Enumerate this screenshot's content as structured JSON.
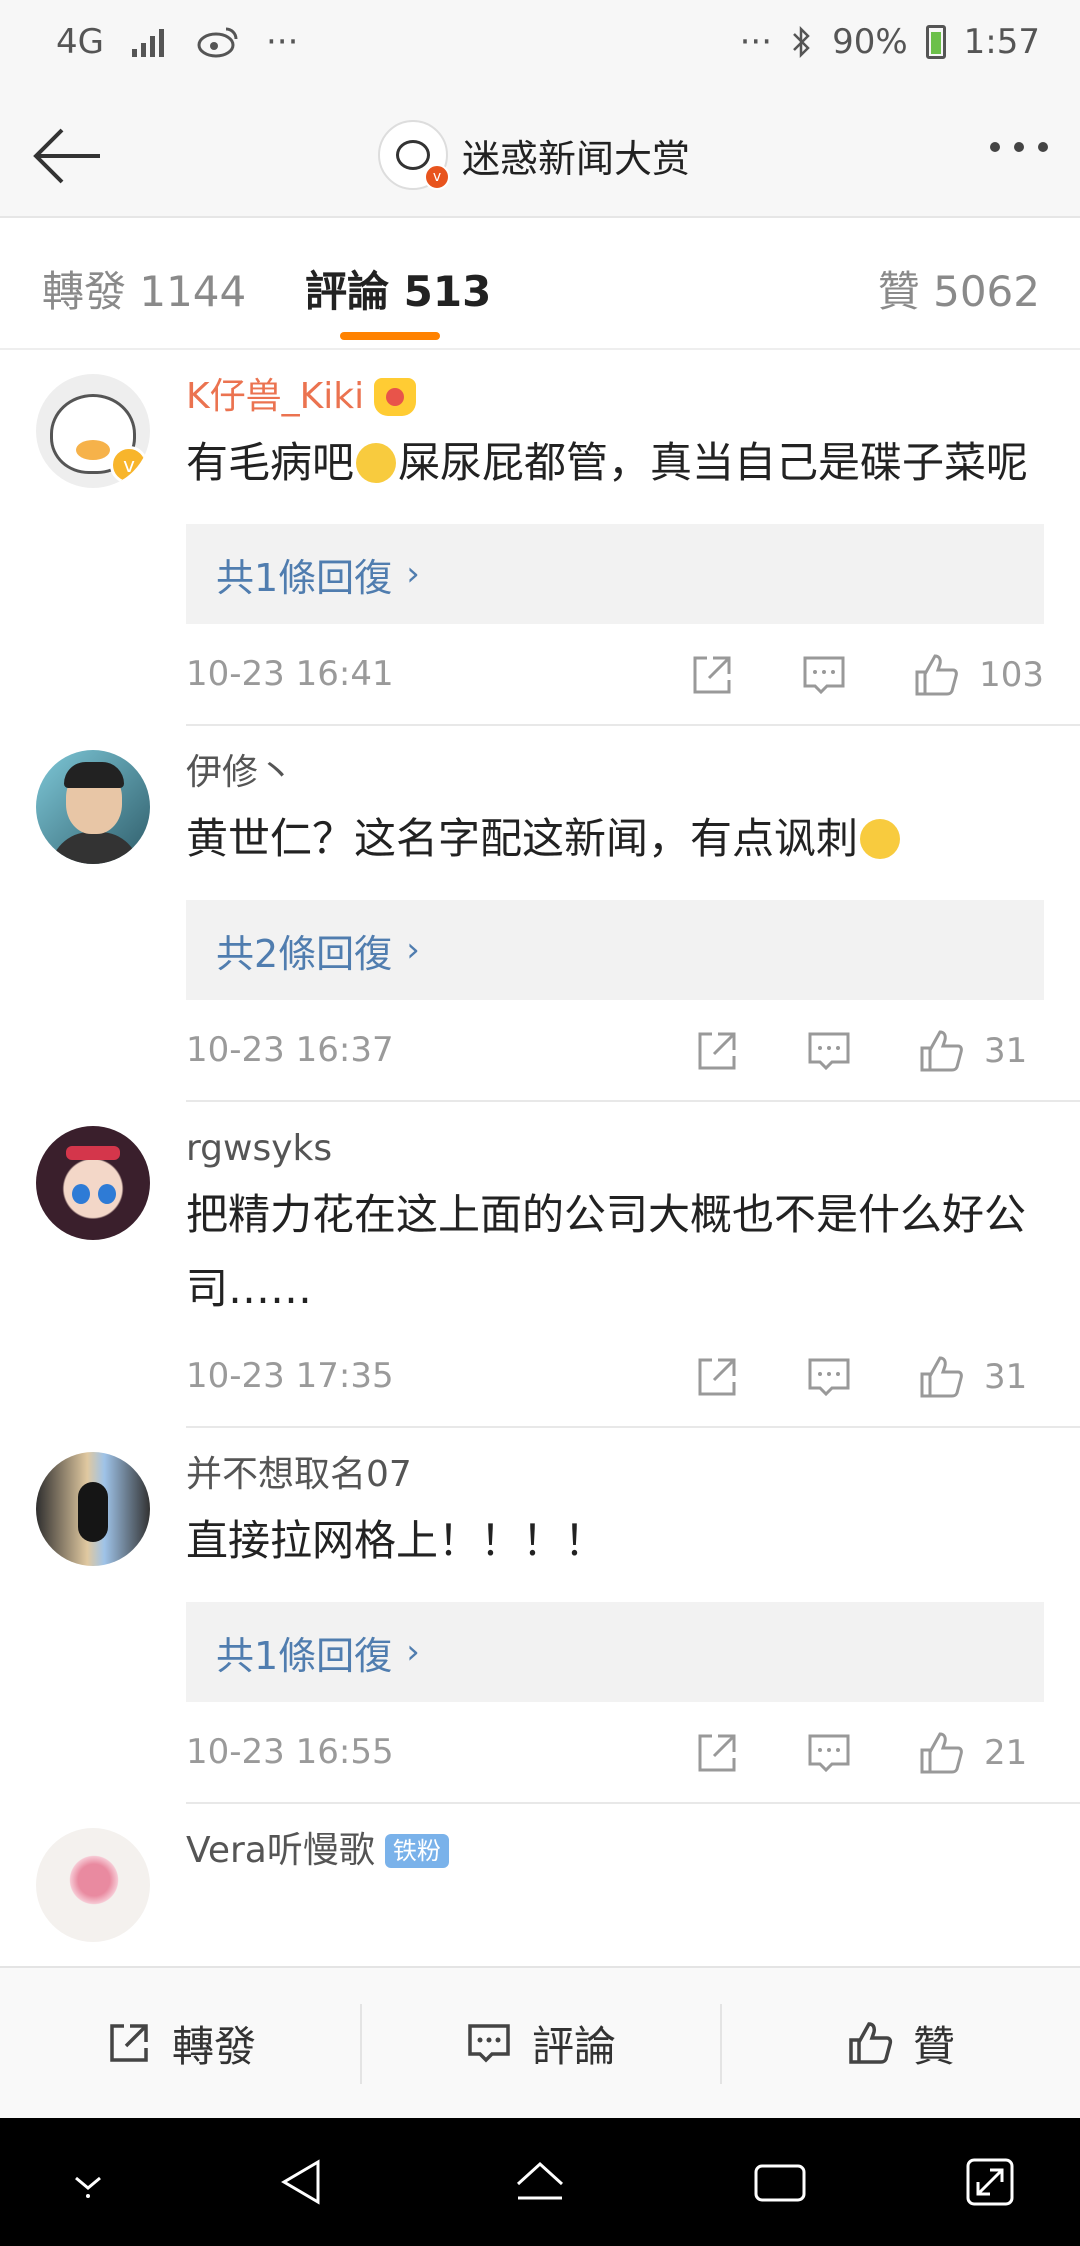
{
  "status_bar": {
    "network": "4G",
    "battery": "90%",
    "time": "1:57",
    "dots_left": "···",
    "dots_right": "···"
  },
  "nav": {
    "title": "迷惑新闻大赏"
  },
  "tabs": [
    {
      "label": "轉發 1144"
    },
    {
      "label": "評論 513"
    },
    {
      "label": "贊 5062"
    }
  ],
  "comments": [
    {
      "user": "K仔兽_Kiki",
      "text_a": "有毛病吧",
      "text_b": "屎尿屁都管，真当自己是碟子菜呢",
      "reply_label": "共1條回復",
      "date": "10-23 16:41",
      "likes": "103"
    },
    {
      "user": "伊修丶",
      "text_a": "黄世仁？这名字配这新闻，有点讽刺",
      "reply_label": "共2條回復",
      "date": "10-23 16:37",
      "likes": "31"
    },
    {
      "user": "rgwsyks",
      "text_a": "把精力花在这上面的公司大概也不是什么好公司……",
      "date": "10-23 17:35",
      "likes": "31"
    },
    {
      "user": "并不想取名07",
      "text_a": "直接拉网格上！！！！",
      "reply_label": "共1條回復",
      "date": "10-23 16:55",
      "likes": "21"
    },
    {
      "user": "Vera听慢歌",
      "badge": "铁粉"
    }
  ],
  "bottom_bar": {
    "repost": "轉發",
    "comment": "評論",
    "like": "贊"
  },
  "colors": {
    "accent": "#ff8200",
    "link": "#507daf",
    "vip_name": "#eb7350"
  }
}
